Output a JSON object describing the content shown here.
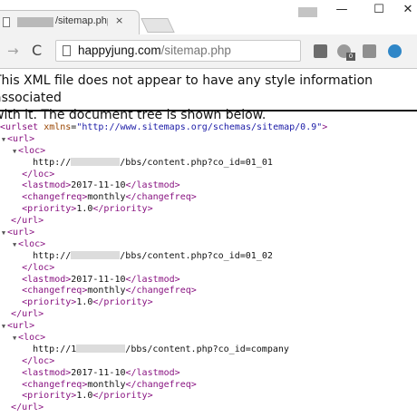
{
  "browser": {
    "tab": {
      "title": "/sitemap.php",
      "close": "×"
    },
    "window_controls": {
      "minimize": "—",
      "maximize": "☐",
      "close": "✕"
    },
    "nav": {
      "forward": "→",
      "reload": "C"
    },
    "url": {
      "host": "happyjung.com",
      "path": "/sitemap.php"
    },
    "extensions": [
      "chart-icon",
      "lab-icon",
      "reader-icon",
      "sync-icon"
    ],
    "ext_badge": "0"
  },
  "page": {
    "info_line1": "This XML file does not appear to have any style information associated",
    "info_line2": "with it. The document tree is shown below."
  },
  "xml": {
    "root_open": "<urlset",
    "root_attr_name": "xmlns",
    "root_attr_value": "\"http://www.sitemaps.org/schemas/sitemap/0.9\"",
    "root_close_bracket": ">",
    "toggle": "▼",
    "url_open": "<url>",
    "url_close": "</url>",
    "loc_open": "<loc>",
    "loc_close": "</loc>",
    "entries": [
      {
        "loc_prefix": "http://",
        "loc_suffix": "/bbs/content.php?co_id=01_01",
        "lastmod_open": "<lastmod>",
        "lastmod": "2017-11-10",
        "lastmod_close": "</lastmod>",
        "changefreq_open": "<changefreq>",
        "changefreq": "monthly",
        "changefreq_close": "</changefreq>",
        "priority_open": "<priority>",
        "priority": "1.0",
        "priority_close": "</priority>"
      },
      {
        "loc_prefix": "http://",
        "loc_suffix": "/bbs/content.php?co_id=01_02",
        "lastmod_open": "<lastmod>",
        "lastmod": "2017-11-10",
        "lastmod_close": "</lastmod>",
        "changefreq_open": "<changefreq>",
        "changefreq": "monthly",
        "changefreq_close": "</changefreq>",
        "priority_open": "<priority>",
        "priority": "1.0",
        "priority_close": "</priority>"
      },
      {
        "loc_prefix": "http://1",
        "loc_suffix": "/bbs/content.php?co_id=company",
        "lastmod_open": "<lastmod>",
        "lastmod": "2017-11-10",
        "lastmod_close": "</lastmod>",
        "changefreq_open": "<changefreq>",
        "changefreq": "monthly",
        "changefreq_close": "</changefreq>",
        "priority_open": "<priority>",
        "priority": "1.0",
        "priority_close": "</priority>"
      }
    ]
  }
}
